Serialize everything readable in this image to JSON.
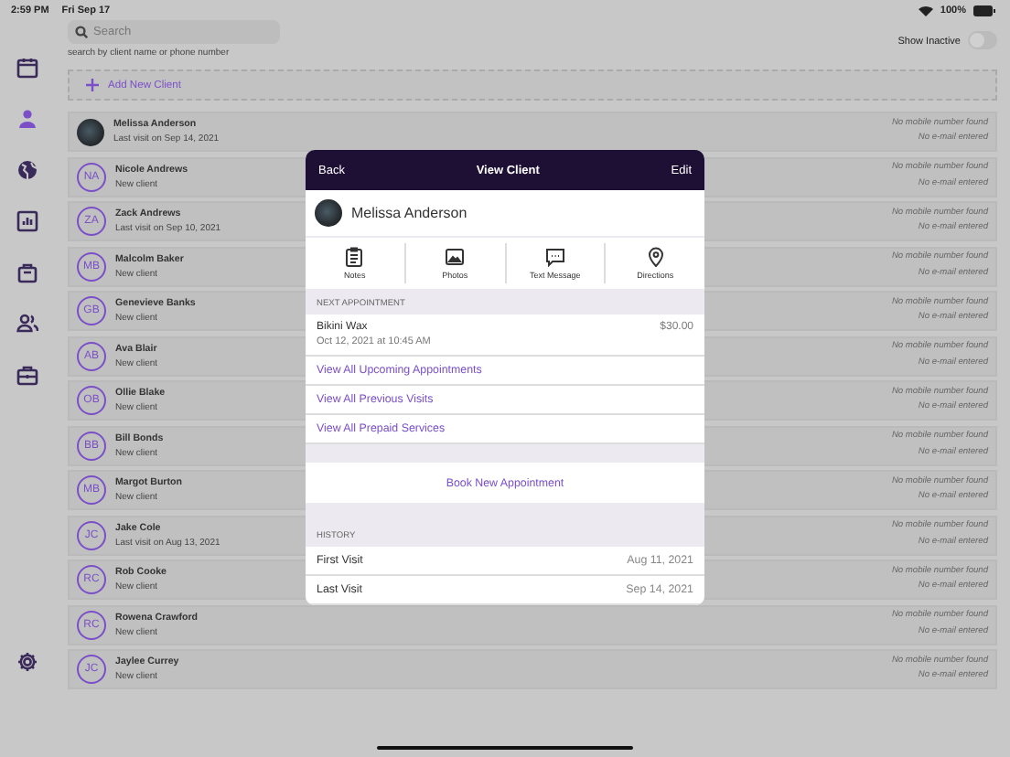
{
  "status_bar": {
    "time": "2:59 PM",
    "date": "Fri Sep 17",
    "battery": "100%"
  },
  "sidebar": {
    "items": [
      {
        "kind": "calendar",
        "selected": false
      },
      {
        "kind": "person",
        "selected": true
      },
      {
        "kind": "globe",
        "selected": false
      },
      {
        "kind": "chart",
        "selected": false
      },
      {
        "kind": "bag",
        "selected": false
      },
      {
        "kind": "people",
        "selected": false
      },
      {
        "kind": "briefcase",
        "selected": false
      },
      {
        "kind": "gear",
        "selected": false
      }
    ]
  },
  "search": {
    "placeholder": "Search",
    "hint": "search by client name or phone number"
  },
  "show_inactive": {
    "label": "Show Inactive",
    "on": false
  },
  "add_client": "Add New Client",
  "clients": [
    {
      "name": "Melissa Anderson",
      "subtitle": "Last visit on Sep 14, 2021",
      "avatar": {
        "kind": "photo"
      },
      "phone": "No mobile number found",
      "email": "No e-mail entered"
    },
    {
      "name": "Nicole Andrews",
      "subtitle": "New client",
      "avatar": {
        "kind": "initials",
        "initials": "NA"
      },
      "phone": "No mobile number found",
      "email": "No e-mail entered"
    },
    {
      "name": "Zack Andrews",
      "subtitle": "Last visit on Sep 10, 2021",
      "avatar": {
        "kind": "initials",
        "initials": "ZA"
      },
      "phone": "No mobile number found",
      "email": "No e-mail entered"
    },
    {
      "name": "Malcolm Baker",
      "subtitle": "New client",
      "avatar": {
        "kind": "initials",
        "initials": "MB"
      },
      "phone": "No mobile number found",
      "email": "No e-mail entered"
    },
    {
      "name": "Genevieve Banks",
      "subtitle": "New client",
      "avatar": {
        "kind": "initials",
        "initials": "GB"
      },
      "phone": "No mobile number found",
      "email": "No e-mail entered"
    },
    {
      "name": "Ava Blair",
      "subtitle": "New client",
      "avatar": {
        "kind": "initials",
        "initials": "AB"
      },
      "phone": "No mobile number found",
      "email": "No e-mail entered"
    },
    {
      "name": "Ollie Blake",
      "subtitle": "New client",
      "avatar": {
        "kind": "initials",
        "initials": "OB"
      },
      "phone": "No mobile number found",
      "email": "No e-mail entered"
    },
    {
      "name": "Bill Bonds",
      "subtitle": "New client",
      "avatar": {
        "kind": "initials",
        "initials": "BB"
      },
      "phone": "No mobile number found",
      "email": "No e-mail entered"
    },
    {
      "name": "Margot Burton",
      "subtitle": "New client",
      "avatar": {
        "kind": "initials",
        "initials": "MB"
      },
      "phone": "No mobile number found",
      "email": "No e-mail entered"
    },
    {
      "name": "Jake Cole",
      "subtitle": "Last visit on Aug 13, 2021",
      "avatar": {
        "kind": "initials",
        "initials": "JC"
      },
      "phone": "No mobile number found",
      "email": "No e-mail entered"
    },
    {
      "name": "Rob Cooke",
      "subtitle": "New client",
      "avatar": {
        "kind": "initials",
        "initials": "RC"
      },
      "phone": "No mobile number found",
      "email": "No e-mail entered"
    },
    {
      "name": "Rowena Crawford",
      "subtitle": "New client",
      "avatar": {
        "kind": "initials",
        "initials": "RC"
      },
      "phone": "No mobile number found",
      "email": "No e-mail entered"
    },
    {
      "name": "Jaylee Currey",
      "subtitle": "New client",
      "avatar": {
        "kind": "initials",
        "initials": "JC"
      },
      "phone": "No mobile number found",
      "email": "No e-mail entered"
    }
  ],
  "modal": {
    "back": "Back",
    "title": "View Client",
    "edit": "Edit",
    "client_name": "Melissa Anderson",
    "actions": [
      {
        "kind": "clipboard",
        "label": "Notes"
      },
      {
        "kind": "photo",
        "label": "Photos"
      },
      {
        "kind": "message",
        "label": "Text Message"
      },
      {
        "kind": "pin",
        "label": "Directions"
      }
    ],
    "next_appointment": {
      "heading": "NEXT APPOINTMENT",
      "service": "Bikini Wax",
      "price": "$30.00",
      "when": "Oct 12, 2021 at 10:45 AM"
    },
    "links": [
      "View All Upcoming Appointments",
      "View All Previous Visits",
      "View All Prepaid Services"
    ],
    "book": "Book New Appointment",
    "history": {
      "heading": "HISTORY",
      "rows": [
        {
          "label": "First Visit",
          "date": "Aug 11, 2021"
        },
        {
          "label": "Last Visit",
          "date": "Sep 14, 2021"
        }
      ]
    }
  }
}
